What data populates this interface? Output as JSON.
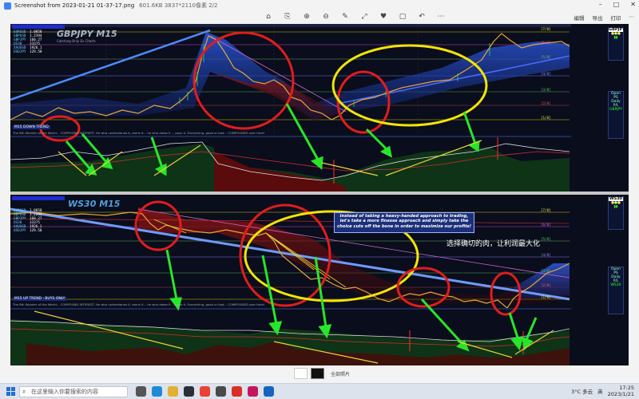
{
  "window": {
    "title": "Screenshot from 2023-01-21 01-37-17.png",
    "file_info": "601.6KB  3837*2110像素  2/2",
    "controls": [
      "–",
      "□",
      "✕"
    ]
  },
  "toolbar": {
    "tools": [
      "⌂",
      "⎘",
      "⊕",
      "⊖",
      "✎",
      "⤢",
      "♥",
      "▢",
      "↶",
      "⋯"
    ],
    "right_items": [
      "编辑",
      "导出",
      "打印",
      "⋯"
    ]
  },
  "chart_top": {
    "symbol": "GBPJPY M15",
    "subtitle": "Catching Only Ex Charts",
    "mode_label": "M15 DOWN TREND",
    "quote": "The 8th Wonder of the World... COMPOUND INTEREST. He who understands it, earns it... he who doesn't ... pays it. Everything, good or bad... COMPOUNDS over time!",
    "stats": [
      {
        "k": "EURUSD",
        "v": "1.0858"
      },
      {
        "k": "GBPUSD",
        "v": "1.2394"
      },
      {
        "k": "GBPJPY",
        "v": "160.27"
      },
      {
        "k": "US30",
        "v": "33375"
      },
      {
        "k": "XAUUSD",
        "v": "1926.1"
      },
      {
        "k": "USDJPY",
        "v": "129.58"
      }
    ],
    "level_labels": [
      "[7/8]",
      "[6/8]",
      "[5/8]",
      "[4/8]",
      "[3/8]",
      "[2/8]",
      "[1/8]"
    ],
    "side_panel": {
      "symbol": "GBPJPY",
      "lines": [
        "Open PS",
        "Daily P/L"
      ],
      "bottom": "GBPJPY"
    }
  },
  "chart_bottom": {
    "symbol": "WS30 M15",
    "mode_label": "M15 UP TREND : BUYS ONLY",
    "quote": "The 8th Wonder of the World... COMPOUND INTEREST. He who understands it, earns it... he who doesn't ... pays it. Everything, good or bad... COMPOUNDS over time!",
    "stats": [
      {
        "k": "EURUSD",
        "v": "1.0858"
      },
      {
        "k": "GBPUSD",
        "v": "1.2394"
      },
      {
        "k": "GBPJPY",
        "v": "160.27"
      },
      {
        "k": "US30",
        "v": "33375"
      },
      {
        "k": "XAUUSD",
        "v": "1926.1"
      },
      {
        "k": "USDJPY",
        "v": "129.58"
      }
    ],
    "level_labels": [
      "[7/8]",
      "[6/8]",
      "[5/8]",
      "[4/8]",
      "[3/8]",
      "[2/8]",
      "[1/8]"
    ],
    "side_panel": {
      "symbol": "WS30",
      "lines": [
        "Open PS",
        "Daily P/L"
      ],
      "bottom": "WS30"
    }
  },
  "annotation": {
    "box_text": "Instead of taking a heavy-handed approach to trading, let's take a more finesse approach and simply take the choice cuts off the bone in order to maximize our profits!",
    "chinese_note": "选择确切的肉，让利润最大化"
  },
  "thumbbar": {
    "all_label": "全部照片"
  },
  "taskbar": {
    "search_placeholder": "在这里输入你要搜索的内容",
    "weather": "3°C 多云",
    "lang": "英",
    "time": "17:25",
    "date": "2023/1/21"
  },
  "colors": {
    "annotation_red": "#e11d1d",
    "annotation_yellow": "#f2e600",
    "arrow_green": "#27e62a",
    "arrow_yellow": "#e8d23a",
    "chart_bg": "#0a0d1c"
  }
}
